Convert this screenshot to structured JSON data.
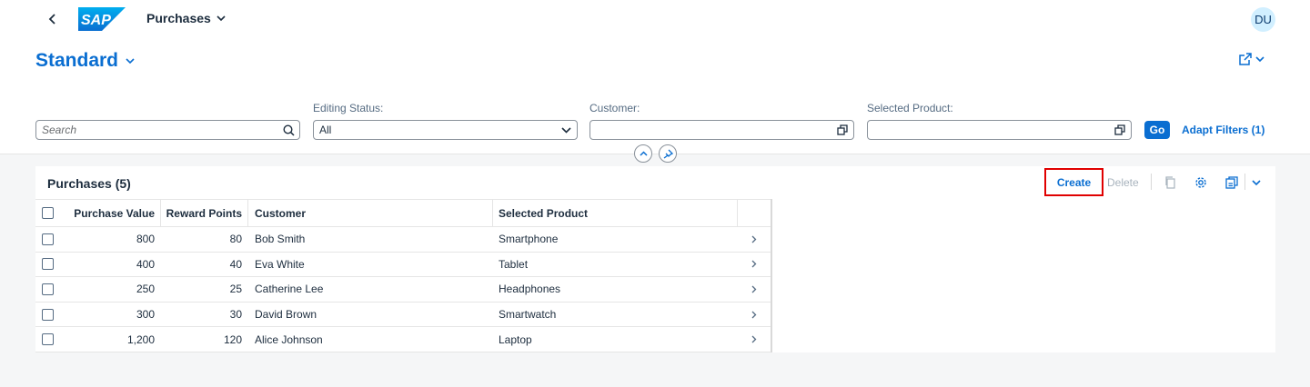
{
  "shell": {
    "title": "Purchases",
    "avatar_initials": "DU",
    "logo_text": "SAP"
  },
  "header": {
    "variant_title": "Standard"
  },
  "filters": {
    "search_placeholder": "Search",
    "editing_status_label": "Editing Status:",
    "editing_status_value": "All",
    "customer_label": "Customer:",
    "customer_value": "",
    "product_label": "Selected Product:",
    "product_value": "",
    "go_label": "Go",
    "adapt_label": "Adapt Filters (1)"
  },
  "table": {
    "title": "Purchases (5)",
    "create_label": "Create",
    "delete_label": "Delete",
    "columns": [
      "Purchase Value",
      "Reward Points",
      "Customer",
      "Selected Product"
    ],
    "rows": [
      {
        "value": "800",
        "points": "80",
        "customer": "Bob Smith",
        "product": "Smartphone"
      },
      {
        "value": "400",
        "points": "40",
        "customer": "Eva White",
        "product": "Tablet"
      },
      {
        "value": "250",
        "points": "25",
        "customer": "Catherine Lee",
        "product": "Headphones"
      },
      {
        "value": "300",
        "points": "30",
        "customer": "David Brown",
        "product": "Smartwatch"
      },
      {
        "value": "1,200",
        "points": "120",
        "customer": "Alice Johnson",
        "product": "Laptop"
      }
    ]
  },
  "colors": {
    "accent": "#0a6ed1",
    "highlight_border": "#e00000"
  }
}
